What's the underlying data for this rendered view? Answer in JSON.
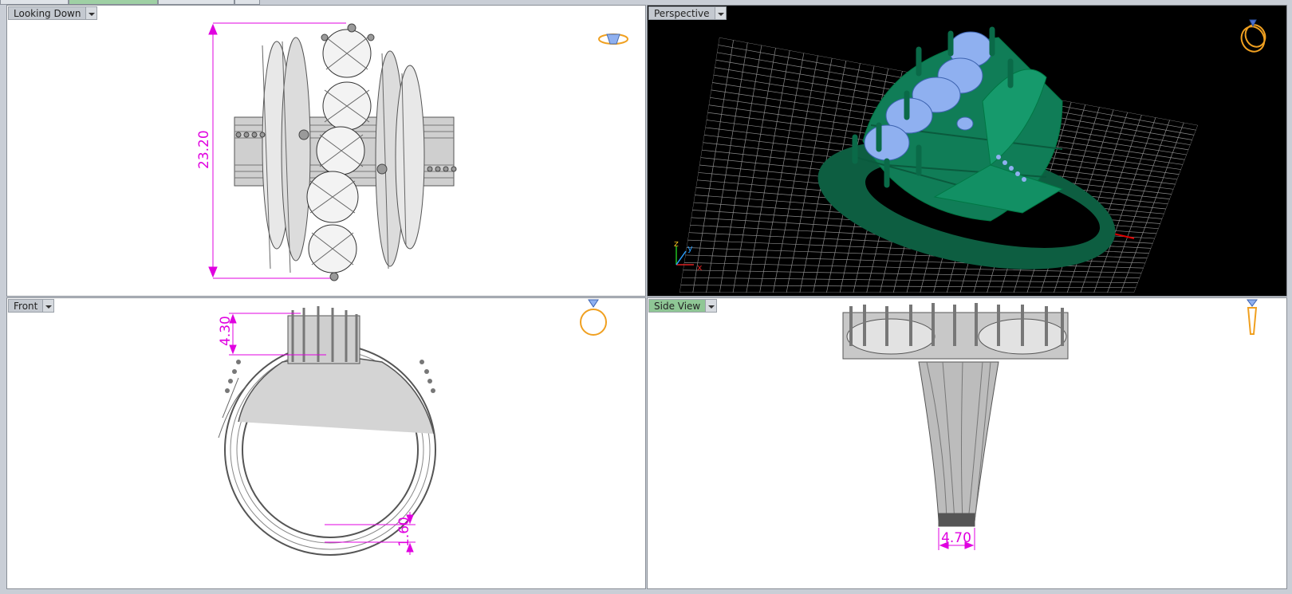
{
  "viewports": {
    "top": {
      "label": "Looking Down",
      "dimension": "23.20"
    },
    "perspective": {
      "label": "Perspective",
      "axis_x": "x",
      "axis_y": "y",
      "axis_z": "z"
    },
    "front": {
      "label": "Front",
      "dimension_top": "4.30",
      "dimension_bottom": "1.60"
    },
    "side": {
      "label": "Side View",
      "dimension": "4.70"
    }
  },
  "icons": {
    "top": "ring-top-view-icon",
    "perspective": "ring-perspective-icon",
    "front": "ring-front-view-icon",
    "side": "ring-side-view-icon"
  },
  "colors": {
    "active_label": "#8fc795",
    "dimension": "#e000e0",
    "model_green": "#0f7a55",
    "gem_blue": "#8fb0f0",
    "view_cube": "#f0a020",
    "grid_axis_red": "#dd0000"
  }
}
